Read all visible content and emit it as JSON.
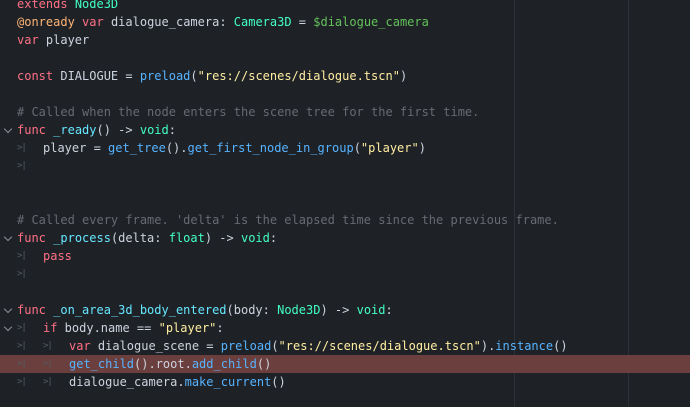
{
  "tab_marker": ">|",
  "lines": [
    {
      "fold": false,
      "highlight": false,
      "indent": 0,
      "tokens": [
        {
          "t": "extends",
          "c": "kw"
        },
        {
          "t": " "
        },
        {
          "t": "Node3D",
          "c": "ty"
        }
      ]
    },
    {
      "fold": false,
      "highlight": false,
      "indent": 0,
      "tokens": [
        {
          "t": "@onready",
          "c": "ann"
        },
        {
          "t": " "
        },
        {
          "t": "var",
          "c": "kw"
        },
        {
          "t": " dialogue_camera: "
        },
        {
          "t": "Camera3D",
          "c": "ty"
        },
        {
          "t": " = "
        },
        {
          "t": "$dialogue_camera",
          "c": "node"
        }
      ]
    },
    {
      "fold": false,
      "highlight": false,
      "indent": 0,
      "tokens": [
        {
          "t": "var",
          "c": "kw"
        },
        {
          "t": " player"
        }
      ]
    },
    {
      "fold": false,
      "highlight": false,
      "indent": 0,
      "tokens": []
    },
    {
      "fold": false,
      "highlight": false,
      "indent": 0,
      "tokens": [
        {
          "t": "const",
          "c": "kw"
        },
        {
          "t": " DIALOGUE = "
        },
        {
          "t": "preload",
          "c": "fn"
        },
        {
          "t": "("
        },
        {
          "t": "\"res://scenes/dialogue.tscn\"",
          "c": "str"
        },
        {
          "t": ")"
        }
      ]
    },
    {
      "fold": false,
      "highlight": false,
      "indent": 0,
      "tokens": []
    },
    {
      "fold": false,
      "highlight": false,
      "indent": 0,
      "tokens": [
        {
          "t": "# Called when the node enters the scene tree for the first time.",
          "c": "cm"
        }
      ]
    },
    {
      "fold": true,
      "highlight": false,
      "indent": 0,
      "tokens": [
        {
          "t": "func",
          "c": "kw"
        },
        {
          "t": " "
        },
        {
          "t": "_ready",
          "c": "fn2"
        },
        {
          "t": "() -> "
        },
        {
          "t": "void",
          "c": "ty"
        },
        {
          "t": ":"
        }
      ]
    },
    {
      "fold": false,
      "highlight": false,
      "indent": 1,
      "tokens": [
        {
          "t": "player = "
        },
        {
          "t": "get_tree",
          "c": "fn"
        },
        {
          "t": "()."
        },
        {
          "t": "get_first_node_in_group",
          "c": "fn"
        },
        {
          "t": "("
        },
        {
          "t": "\"player\"",
          "c": "str"
        },
        {
          "t": ")"
        }
      ]
    },
    {
      "fold": false,
      "highlight": false,
      "indent": 1,
      "tokens": []
    },
    {
      "fold": false,
      "highlight": false,
      "indent": 0,
      "tokens": []
    },
    {
      "fold": false,
      "highlight": false,
      "indent": 0,
      "tokens": []
    },
    {
      "fold": false,
      "highlight": false,
      "indent": 0,
      "tokens": [
        {
          "t": "# Called every frame. 'delta' is the elapsed time since the previous frame.",
          "c": "cm"
        }
      ]
    },
    {
      "fold": true,
      "highlight": false,
      "indent": 0,
      "tokens": [
        {
          "t": "func",
          "c": "kw"
        },
        {
          "t": " "
        },
        {
          "t": "_process",
          "c": "fn2"
        },
        {
          "t": "(delta: "
        },
        {
          "t": "float",
          "c": "ty"
        },
        {
          "t": ") -> "
        },
        {
          "t": "void",
          "c": "ty"
        },
        {
          "t": ":"
        }
      ]
    },
    {
      "fold": false,
      "highlight": false,
      "indent": 1,
      "tokens": [
        {
          "t": "pass",
          "c": "kw"
        }
      ]
    },
    {
      "fold": false,
      "highlight": false,
      "indent": 1,
      "tokens": []
    },
    {
      "fold": false,
      "highlight": false,
      "indent": 0,
      "tokens": []
    },
    {
      "fold": true,
      "highlight": false,
      "indent": 0,
      "tokens": [
        {
          "t": "func",
          "c": "kw"
        },
        {
          "t": " "
        },
        {
          "t": "_on_area_3d_body_entered",
          "c": "fn2"
        },
        {
          "t": "(body: "
        },
        {
          "t": "Node3D",
          "c": "ty"
        },
        {
          "t": ") -> "
        },
        {
          "t": "void",
          "c": "ty"
        },
        {
          "t": ":"
        }
      ]
    },
    {
      "fold": true,
      "highlight": false,
      "indent": 1,
      "tokens": [
        {
          "t": "if",
          "c": "kw"
        },
        {
          "t": " body.name == "
        },
        {
          "t": "\"player\"",
          "c": "str"
        },
        {
          "t": ":"
        }
      ]
    },
    {
      "fold": false,
      "highlight": false,
      "indent": 2,
      "tokens": [
        {
          "t": "var",
          "c": "kw"
        },
        {
          "t": " dialogue_scene = "
        },
        {
          "t": "preload",
          "c": "fn"
        },
        {
          "t": "("
        },
        {
          "t": "\"res://scenes/dialogue.tscn\"",
          "c": "str"
        },
        {
          "t": ")."
        },
        {
          "t": "instance",
          "c": "fn"
        },
        {
          "t": "()"
        }
      ]
    },
    {
      "fold": false,
      "highlight": true,
      "indent": 2,
      "tokens": [
        {
          "t": "get_child",
          "c": "fn"
        },
        {
          "t": "().root."
        },
        {
          "t": "add_child",
          "c": "fn"
        },
        {
          "t": "()"
        }
      ]
    },
    {
      "fold": false,
      "highlight": false,
      "indent": 2,
      "tokens": [
        {
          "t": "dialogue_camera."
        },
        {
          "t": "make_current",
          "c": "fn"
        },
        {
          "t": "()"
        }
      ]
    }
  ]
}
